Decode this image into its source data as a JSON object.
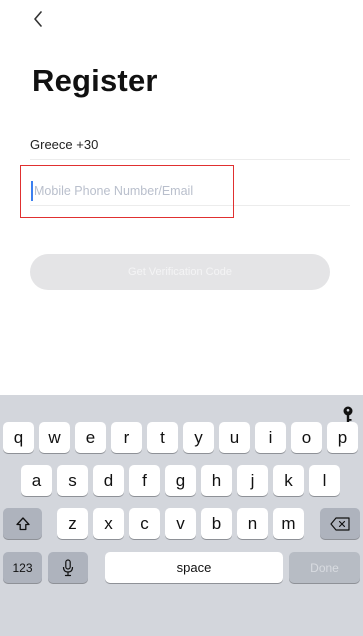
{
  "header": {
    "back_icon": "chevron-left-icon"
  },
  "title": "Register",
  "country": {
    "label": "Greece +30"
  },
  "phone_input": {
    "placeholder": "Mobile Phone Number/Email",
    "value": ""
  },
  "verify_button": {
    "label": "Get Verification Code"
  },
  "keyboard": {
    "accessory_icon": "key-icon",
    "row1": [
      "q",
      "w",
      "e",
      "r",
      "t",
      "y",
      "u",
      "i",
      "o",
      "p"
    ],
    "row2": [
      "a",
      "s",
      "d",
      "f",
      "g",
      "h",
      "j",
      "k",
      "l"
    ],
    "row3": [
      "z",
      "x",
      "c",
      "v",
      "b",
      "n",
      "m"
    ],
    "shift_icon": "shift-icon",
    "delete_icon": "backspace-icon",
    "numbers_label": "123",
    "mic_icon": "microphone-icon",
    "space_label": "space",
    "done_label": "Done"
  },
  "colors": {
    "highlight_border": "#e03030",
    "keyboard_bg": "#d3d6dc",
    "button_disabled": "#e4e4e6"
  }
}
